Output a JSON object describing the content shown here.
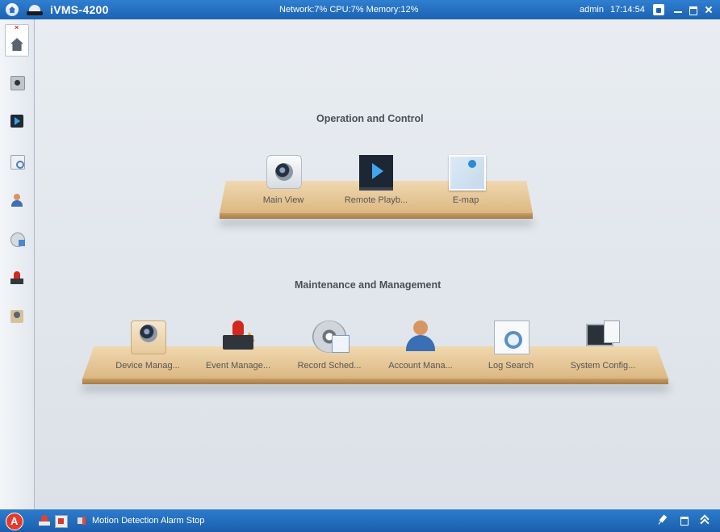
{
  "titlebar": {
    "app_name": "iVMS-4200",
    "status": "Network:7% CPU:7% Memory:12%",
    "user": "admin",
    "time": "17:14:54"
  },
  "sidebar": {
    "items": [
      {
        "icon": "home-icon",
        "active": true
      },
      {
        "icon": "camera-icon"
      },
      {
        "icon": "playback-icon"
      },
      {
        "icon": "log-search-icon"
      },
      {
        "icon": "account-icon"
      },
      {
        "icon": "record-schedule-icon"
      },
      {
        "icon": "event-alarm-icon"
      },
      {
        "icon": "device-icon"
      }
    ]
  },
  "operation": {
    "title": "Operation and Control",
    "items": [
      {
        "label": "Main View",
        "icon": "main-view-icon"
      },
      {
        "label": "Remote Playb...",
        "icon": "remote-playback-icon"
      },
      {
        "label": "E-map",
        "icon": "e-map-icon"
      }
    ]
  },
  "maintenance": {
    "title": "Maintenance and Management",
    "items": [
      {
        "label": "Device Manag...",
        "icon": "device-management-icon"
      },
      {
        "label": "Event Manage...",
        "icon": "event-management-icon"
      },
      {
        "label": "Record Sched...",
        "icon": "record-schedule-icon"
      },
      {
        "label": "Account Mana...",
        "icon": "account-management-icon"
      },
      {
        "label": "Log Search",
        "icon": "log-search-icon"
      },
      {
        "label": "System Config...",
        "icon": "system-config-icon"
      }
    ]
  },
  "statusbar": {
    "message": "Motion Detection Alarm Stop"
  },
  "colors": {
    "titlebar": "#1c62b3",
    "shelf": "#dcb882",
    "background": "#e3e8ee"
  }
}
